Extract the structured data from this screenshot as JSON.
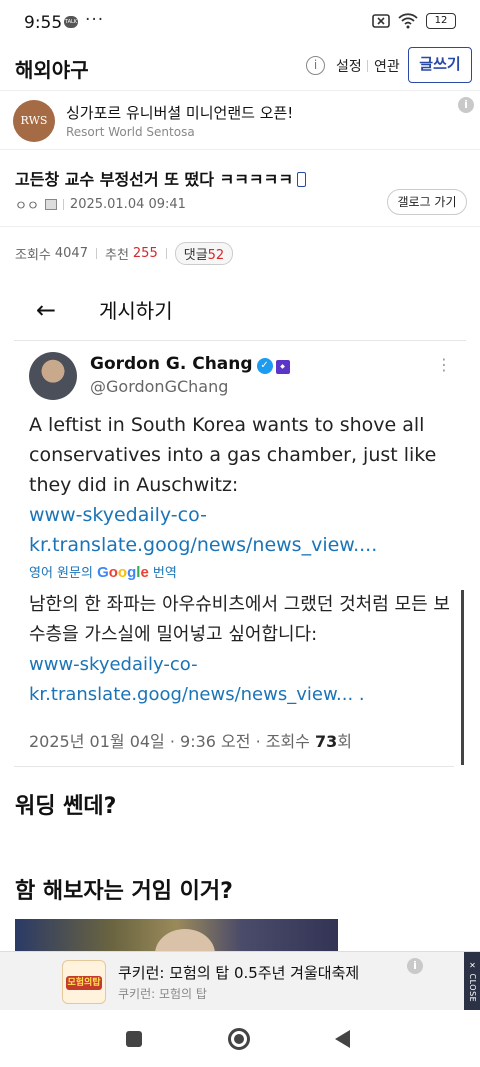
{
  "status_bar": {
    "time": "9:55",
    "talk": "TALK",
    "dots": "···",
    "wifi": "wifi",
    "battery": "12"
  },
  "header": {
    "title": "해외야구",
    "info": "i",
    "settings": "설정",
    "related": "연관",
    "write": "글쓰기"
  },
  "top_ad": {
    "logo": "RWS",
    "title": "싱가포르 유니버셜 미니언랜드 오픈!",
    "subtitle": "Resort World Sentosa",
    "info": "i"
  },
  "post": {
    "title": "고든창 교수 부정선거 또 떴다 ㅋㅋㅋㅋㅋ",
    "author": "ㅇㅇ",
    "date": "2025.01.04 09:41",
    "gallery_button": "갤로그 가기",
    "views_label": "조회수",
    "views": "4047",
    "likes_label": "추천",
    "likes": "255",
    "comments_label": "댓글",
    "comments": "52"
  },
  "embed": {
    "header_title": "게시하기",
    "back": "←",
    "name": "Gordon G. Chang",
    "handle": "@GordonGChang",
    "more": "⋮",
    "text_en": "A leftist in South Korea wants to shove all conservatives into a gas chamber, just like they did in Auschwitz:",
    "link_en": "www-skyedaily-co-kr.translate.goog/news/news_view....",
    "translate_prefix": "영어 원문의",
    "translate_google": "Google",
    "translate_suffix": "번역",
    "text_ko": "남한의 한 좌파는 아우슈비츠에서 그랬던 것처럼 모든 보수층을 가스실에 밀어넣고 싶어합니다:",
    "link_ko": "www-skyedaily-co-kr.translate.goog/news/news_view... .",
    "date": "2025년 01월 04일 · 9:36 오전 · 조회수",
    "views": "73",
    "views_suffix": "회"
  },
  "body": {
    "line1": "워딩 쎈데?",
    "line2": "함 해보자는 거임 이거?"
  },
  "bottom_ad": {
    "logo_text": "모험의탑",
    "title": "쿠키런: 모험의 탑 0.5주년 겨울대축제",
    "subtitle": "쿠키런: 모험의 탑",
    "info": "i",
    "close": "✕ CLOSE"
  },
  "colors": {
    "accent_blue": "#2a49a7",
    "link": "#1b74b7",
    "red": "#d12a2a"
  }
}
